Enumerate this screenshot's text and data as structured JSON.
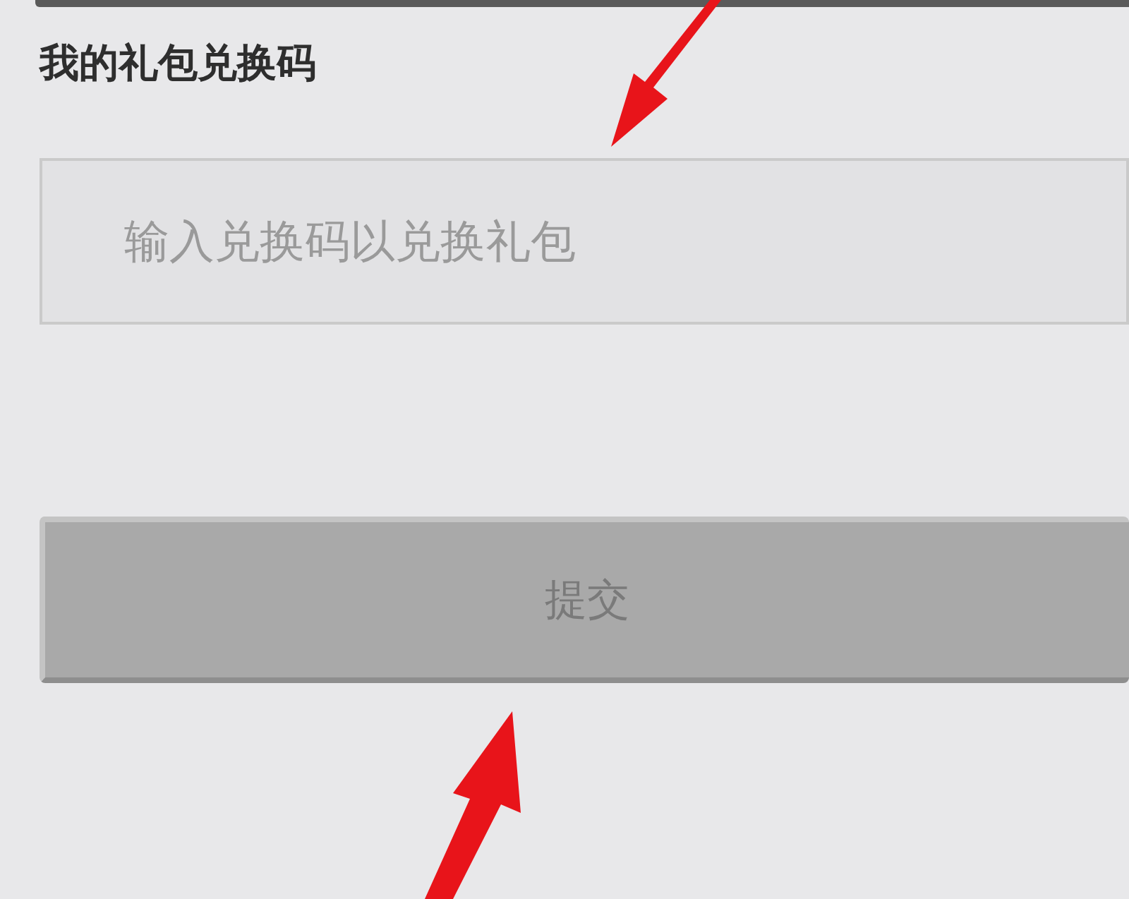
{
  "title": "我的礼包兑换码",
  "redeem_field": {
    "placeholder": "输入兑换码以兑换礼包"
  },
  "submit_button": {
    "label": "提交"
  }
}
